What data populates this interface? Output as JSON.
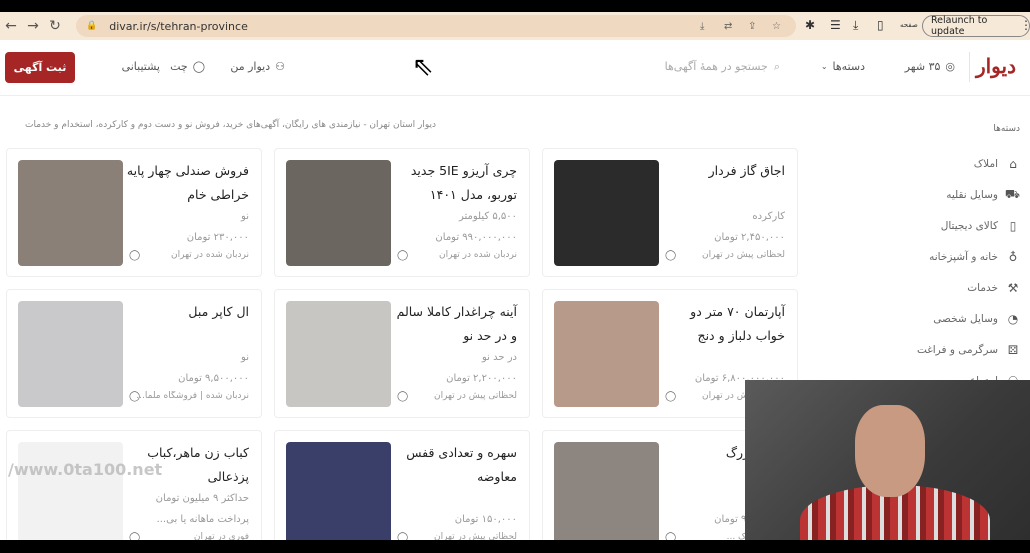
{
  "browser": {
    "url": "divar.ir/s/tehran-province",
    "relaunch": "Relaunch to update",
    "profile_label": "صفحه"
  },
  "header": {
    "logo": "دیوار",
    "city": "۳۵ شهر",
    "categories": "دسته‌ها",
    "search_placeholder": "جستجو در همهٔ آگهی‌ها",
    "my_divar": "دیوار من",
    "chat": "چت",
    "support": "پشتیبانی",
    "post_ad": "ثبت آگهی"
  },
  "description": "دیوار استان تهران - نیازمندی های رایگان، آگهی‌های خرید، فروش نو و دست دوم و کارکرده، استخدام و خدمات",
  "sidebar": {
    "title": "دسته‌ها",
    "items": [
      {
        "label": "املاک",
        "icon": "building-icon"
      },
      {
        "label": "وسایل نقلیه",
        "icon": "car-icon"
      },
      {
        "label": "کالای دیجیتال",
        "icon": "phone-icon"
      },
      {
        "label": "خانه و آشپزخانه",
        "icon": "lamp-icon"
      },
      {
        "label": "خدمات",
        "icon": "brush-icon"
      },
      {
        "label": "وسایل شخصی",
        "icon": "watch-icon"
      },
      {
        "label": "سرگرمی و فراغت",
        "icon": "dice-icon"
      },
      {
        "label": "اجتماعی",
        "icon": "people-icon"
      }
    ]
  },
  "listings": [
    {
      "title": "اجاق گاز فردار",
      "l1": "کارکرده",
      "l2": "۲,۴۵۰,۰۰۰ تومان",
      "l3": "لحظاتی پیش در تهران",
      "img": "#2b2b2b"
    },
    {
      "title": "چری آریزو 5IE جدید توربو، مدل ۱۴۰۱",
      "l1": "۵,۵۰۰ کیلومتر",
      "l2": "۹۹۰,۰۰۰,۰۰۰ تومان",
      "l3": "نردبان شده در تهران",
      "img": "#6b6660"
    },
    {
      "title": "فروش صندلی چهار پایه خراطی خام",
      "l1": "نو",
      "l2": "۲۳۰,۰۰۰ تومان",
      "l3": "نردبان شده در تهران",
      "img": "#8a8078"
    },
    {
      "title": "آپارتمان ۷۰ متر دو خواب دلباز و دنج",
      "l1": "",
      "l2": "۶,۸۰۰,۰۰۰,۰۰۰ تومان",
      "l3": "لحظاتی پیش در تهران",
      "img": "#b89a8a"
    },
    {
      "title": "آینه چراغدار کاملا سالم و در حد نو",
      "l1": "در حد نو",
      "l2": "۲,۲۰۰,۰۰۰ تومان",
      "l3": "لحظاتی پیش در تهران",
      "img": "#c8c6c2"
    },
    {
      "title": "ال کاپر مبل",
      "l1": "نو",
      "l2": "۹,۵۰۰,۰۰۰ تومان",
      "l3": "نردبان شده | فروشگاه ملما...",
      "img": "#c9c9cc"
    },
    {
      "title": "سالن بزرگ",
      "l1": "",
      "l2": "۹,۷۰۰,۰۰۰ تومان",
      "l3": "آژانس املاک ...",
      "img": "#8d8580"
    },
    {
      "title": "سهره و تعدادی قفس معاوضه",
      "l1": "",
      "l2": "۱۵۰,۰۰۰ تومان",
      "l3": "لحظاتی پیش در تهران",
      "img": "#3a3f6a"
    },
    {
      "title": "کباب زن ماهر،کباب پزذعالی",
      "l1": "حداکثر ۹ میلیون تومان",
      "l2": "پرداخت ماهانه یا بی...",
      "l3": "فوری در تهران",
      "img": "#f2f2f2"
    }
  ],
  "watermark": "/www.0ta100.net"
}
